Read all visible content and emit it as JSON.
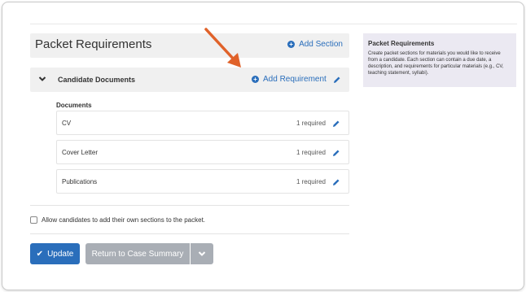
{
  "header": {
    "title": "Packet Requirements",
    "add_section_label": "Add Section"
  },
  "section": {
    "title": "Candidate Documents",
    "add_requirement_label": "Add Requirement",
    "documents_label": "Documents",
    "documents": [
      {
        "name": "CV",
        "required": "1 required"
      },
      {
        "name": "Cover Letter",
        "required": "1 required"
      },
      {
        "name": "Publications",
        "required": "1 required"
      }
    ]
  },
  "allow_checkbox": {
    "label": "Allow candidates to add their own sections to the packet."
  },
  "buttons": {
    "update_label": "Update",
    "return_label": "Return to Case Summary"
  },
  "help": {
    "title": "Packet Requirements",
    "text": "Create packet sections for materials you would like to receive from a candidate. Each section can contain a due date, a description, and requirements for particular materials (e.g., CV, teaching statement, syllabi)."
  },
  "colors": {
    "accent": "#2a6ebb",
    "secondary_button": "#a9aeb5",
    "help_bg": "#ebe9f2",
    "annotation_arrow": "#e0622a"
  },
  "icons": {
    "add": "plus-circle-icon",
    "collapse": "chevron-down-icon",
    "edit": "pencil-icon",
    "confirm": "check-icon",
    "dropdown": "chevron-down-icon"
  }
}
